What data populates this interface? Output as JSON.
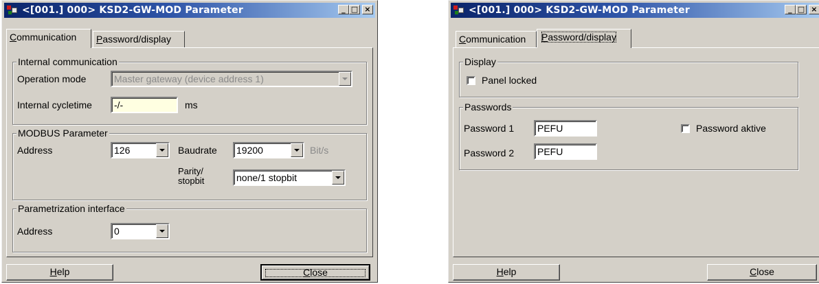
{
  "left_window": {
    "title": "<[001.] 000> KSD2-GW-MOD Parameter",
    "tabs": [
      {
        "mnemonic": "C",
        "rest": "ommunication"
      },
      {
        "mnemonic": "P",
        "rest": "assword/display"
      }
    ],
    "internal_comm": {
      "title": "Internal communication",
      "operation_mode_label": "Operation mode",
      "operation_mode_value": "Master gateway (device address 1)",
      "cycletime_label": "Internal cycletime",
      "cycletime_value": "-/-",
      "cycletime_unit": "ms"
    },
    "modbus": {
      "title": "MODBUS Parameter",
      "address_label": "Address",
      "address_value": "126",
      "baudrate_label": "Baudrate",
      "baudrate_value": "19200",
      "baudrate_unit": "Bit/s",
      "parity_label_1": "Parity/",
      "parity_label_2": "stopbit",
      "parity_value": "none/1 stopbit"
    },
    "param_iface": {
      "title": "Parametrization interface",
      "address_label": "Address",
      "address_value": "0"
    },
    "help_button": {
      "mnemonic": "H",
      "rest": "elp"
    },
    "close_button": {
      "mnemonic": "C",
      "rest": "lose"
    }
  },
  "right_window": {
    "title": "<[001.] 000> KSD2-GW-MOD Parameter",
    "tabs": [
      {
        "mnemonic": "C",
        "rest": "ommunication"
      },
      {
        "mnemonic": "P",
        "rest": "assword/display"
      }
    ],
    "display": {
      "title": "Display",
      "panel_locked_label": "Panel locked"
    },
    "passwords": {
      "title": "Passwords",
      "password1_label": "Password 1",
      "password1_value": "PEFU",
      "password2_label": "Password 2",
      "password2_value": "PEFU",
      "password_active_label": "Password aktive"
    },
    "help_button": {
      "mnemonic": "H",
      "rest": "elp"
    },
    "close_button": {
      "mnemonic": "C",
      "rest": "lose"
    }
  },
  "icons": [
    "app-icon",
    "minimize-icon",
    "maximize-icon",
    "close-icon",
    "chevron-down-icon"
  ],
  "colors": {
    "titlebar_start": "#0a246a",
    "titlebar_end": "#a6caf0",
    "face": "#d4d0c8",
    "highlight_field": "#ffffe1"
  }
}
